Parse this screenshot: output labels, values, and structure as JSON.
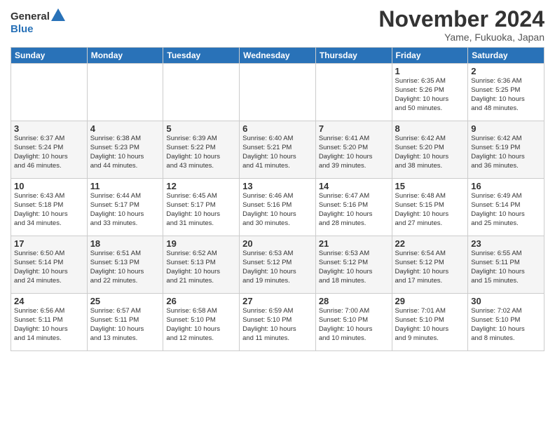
{
  "logo": {
    "line1": "General",
    "line2": "Blue"
  },
  "title": "November 2024",
  "subtitle": "Yame, Fukuoka, Japan",
  "weekdays": [
    "Sunday",
    "Monday",
    "Tuesday",
    "Wednesday",
    "Thursday",
    "Friday",
    "Saturday"
  ],
  "weeks": [
    [
      {
        "day": "",
        "info": ""
      },
      {
        "day": "",
        "info": ""
      },
      {
        "day": "",
        "info": ""
      },
      {
        "day": "",
        "info": ""
      },
      {
        "day": "",
        "info": ""
      },
      {
        "day": "1",
        "info": "Sunrise: 6:35 AM\nSunset: 5:26 PM\nDaylight: 10 hours\nand 50 minutes."
      },
      {
        "day": "2",
        "info": "Sunrise: 6:36 AM\nSunset: 5:25 PM\nDaylight: 10 hours\nand 48 minutes."
      }
    ],
    [
      {
        "day": "3",
        "info": "Sunrise: 6:37 AM\nSunset: 5:24 PM\nDaylight: 10 hours\nand 46 minutes."
      },
      {
        "day": "4",
        "info": "Sunrise: 6:38 AM\nSunset: 5:23 PM\nDaylight: 10 hours\nand 44 minutes."
      },
      {
        "day": "5",
        "info": "Sunrise: 6:39 AM\nSunset: 5:22 PM\nDaylight: 10 hours\nand 43 minutes."
      },
      {
        "day": "6",
        "info": "Sunrise: 6:40 AM\nSunset: 5:21 PM\nDaylight: 10 hours\nand 41 minutes."
      },
      {
        "day": "7",
        "info": "Sunrise: 6:41 AM\nSunset: 5:20 PM\nDaylight: 10 hours\nand 39 minutes."
      },
      {
        "day": "8",
        "info": "Sunrise: 6:42 AM\nSunset: 5:20 PM\nDaylight: 10 hours\nand 38 minutes."
      },
      {
        "day": "9",
        "info": "Sunrise: 6:42 AM\nSunset: 5:19 PM\nDaylight: 10 hours\nand 36 minutes."
      }
    ],
    [
      {
        "day": "10",
        "info": "Sunrise: 6:43 AM\nSunset: 5:18 PM\nDaylight: 10 hours\nand 34 minutes."
      },
      {
        "day": "11",
        "info": "Sunrise: 6:44 AM\nSunset: 5:17 PM\nDaylight: 10 hours\nand 33 minutes."
      },
      {
        "day": "12",
        "info": "Sunrise: 6:45 AM\nSunset: 5:17 PM\nDaylight: 10 hours\nand 31 minutes."
      },
      {
        "day": "13",
        "info": "Sunrise: 6:46 AM\nSunset: 5:16 PM\nDaylight: 10 hours\nand 30 minutes."
      },
      {
        "day": "14",
        "info": "Sunrise: 6:47 AM\nSunset: 5:16 PM\nDaylight: 10 hours\nand 28 minutes."
      },
      {
        "day": "15",
        "info": "Sunrise: 6:48 AM\nSunset: 5:15 PM\nDaylight: 10 hours\nand 27 minutes."
      },
      {
        "day": "16",
        "info": "Sunrise: 6:49 AM\nSunset: 5:14 PM\nDaylight: 10 hours\nand 25 minutes."
      }
    ],
    [
      {
        "day": "17",
        "info": "Sunrise: 6:50 AM\nSunset: 5:14 PM\nDaylight: 10 hours\nand 24 minutes."
      },
      {
        "day": "18",
        "info": "Sunrise: 6:51 AM\nSunset: 5:13 PM\nDaylight: 10 hours\nand 22 minutes."
      },
      {
        "day": "19",
        "info": "Sunrise: 6:52 AM\nSunset: 5:13 PM\nDaylight: 10 hours\nand 21 minutes."
      },
      {
        "day": "20",
        "info": "Sunrise: 6:53 AM\nSunset: 5:12 PM\nDaylight: 10 hours\nand 19 minutes."
      },
      {
        "day": "21",
        "info": "Sunrise: 6:53 AM\nSunset: 5:12 PM\nDaylight: 10 hours\nand 18 minutes."
      },
      {
        "day": "22",
        "info": "Sunrise: 6:54 AM\nSunset: 5:12 PM\nDaylight: 10 hours\nand 17 minutes."
      },
      {
        "day": "23",
        "info": "Sunrise: 6:55 AM\nSunset: 5:11 PM\nDaylight: 10 hours\nand 15 minutes."
      }
    ],
    [
      {
        "day": "24",
        "info": "Sunrise: 6:56 AM\nSunset: 5:11 PM\nDaylight: 10 hours\nand 14 minutes."
      },
      {
        "day": "25",
        "info": "Sunrise: 6:57 AM\nSunset: 5:11 PM\nDaylight: 10 hours\nand 13 minutes."
      },
      {
        "day": "26",
        "info": "Sunrise: 6:58 AM\nSunset: 5:10 PM\nDaylight: 10 hours\nand 12 minutes."
      },
      {
        "day": "27",
        "info": "Sunrise: 6:59 AM\nSunset: 5:10 PM\nDaylight: 10 hours\nand 11 minutes."
      },
      {
        "day": "28",
        "info": "Sunrise: 7:00 AM\nSunset: 5:10 PM\nDaylight: 10 hours\nand 10 minutes."
      },
      {
        "day": "29",
        "info": "Sunrise: 7:01 AM\nSunset: 5:10 PM\nDaylight: 10 hours\nand 9 minutes."
      },
      {
        "day": "30",
        "info": "Sunrise: 7:02 AM\nSunset: 5:10 PM\nDaylight: 10 hours\nand 8 minutes."
      }
    ]
  ]
}
